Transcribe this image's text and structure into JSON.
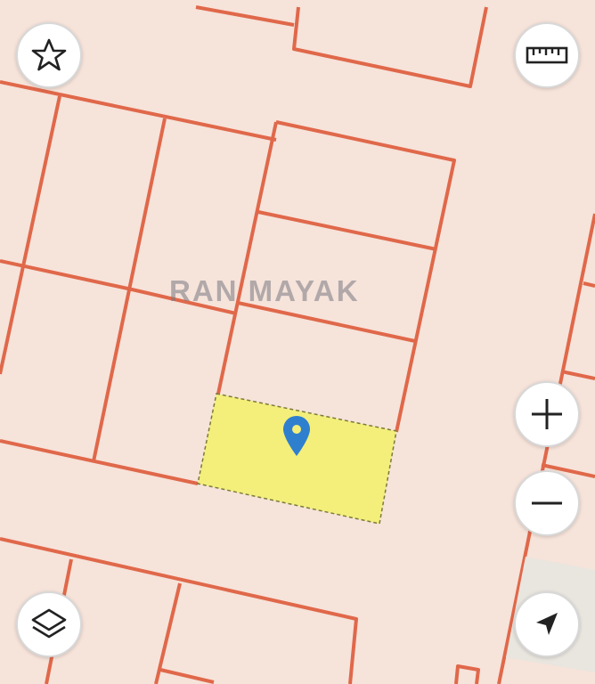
{
  "map": {
    "watermark": "RAN MAYAK",
    "colors": {
      "background": "#f6e3da",
      "parcel_border": "#e0684a",
      "selected_fill": "#f4ef7a",
      "selected_border": "#7a7a3a",
      "marker": "#2f7fcf"
    }
  },
  "controls": {
    "favorite": {
      "icon": "star-icon"
    },
    "measure": {
      "icon": "ruler-icon"
    },
    "zoom_in": {
      "icon": "plus-icon"
    },
    "zoom_out": {
      "icon": "minus-icon"
    },
    "layers": {
      "icon": "layers-icon"
    },
    "locate": {
      "icon": "navigation-arrow-icon"
    }
  }
}
